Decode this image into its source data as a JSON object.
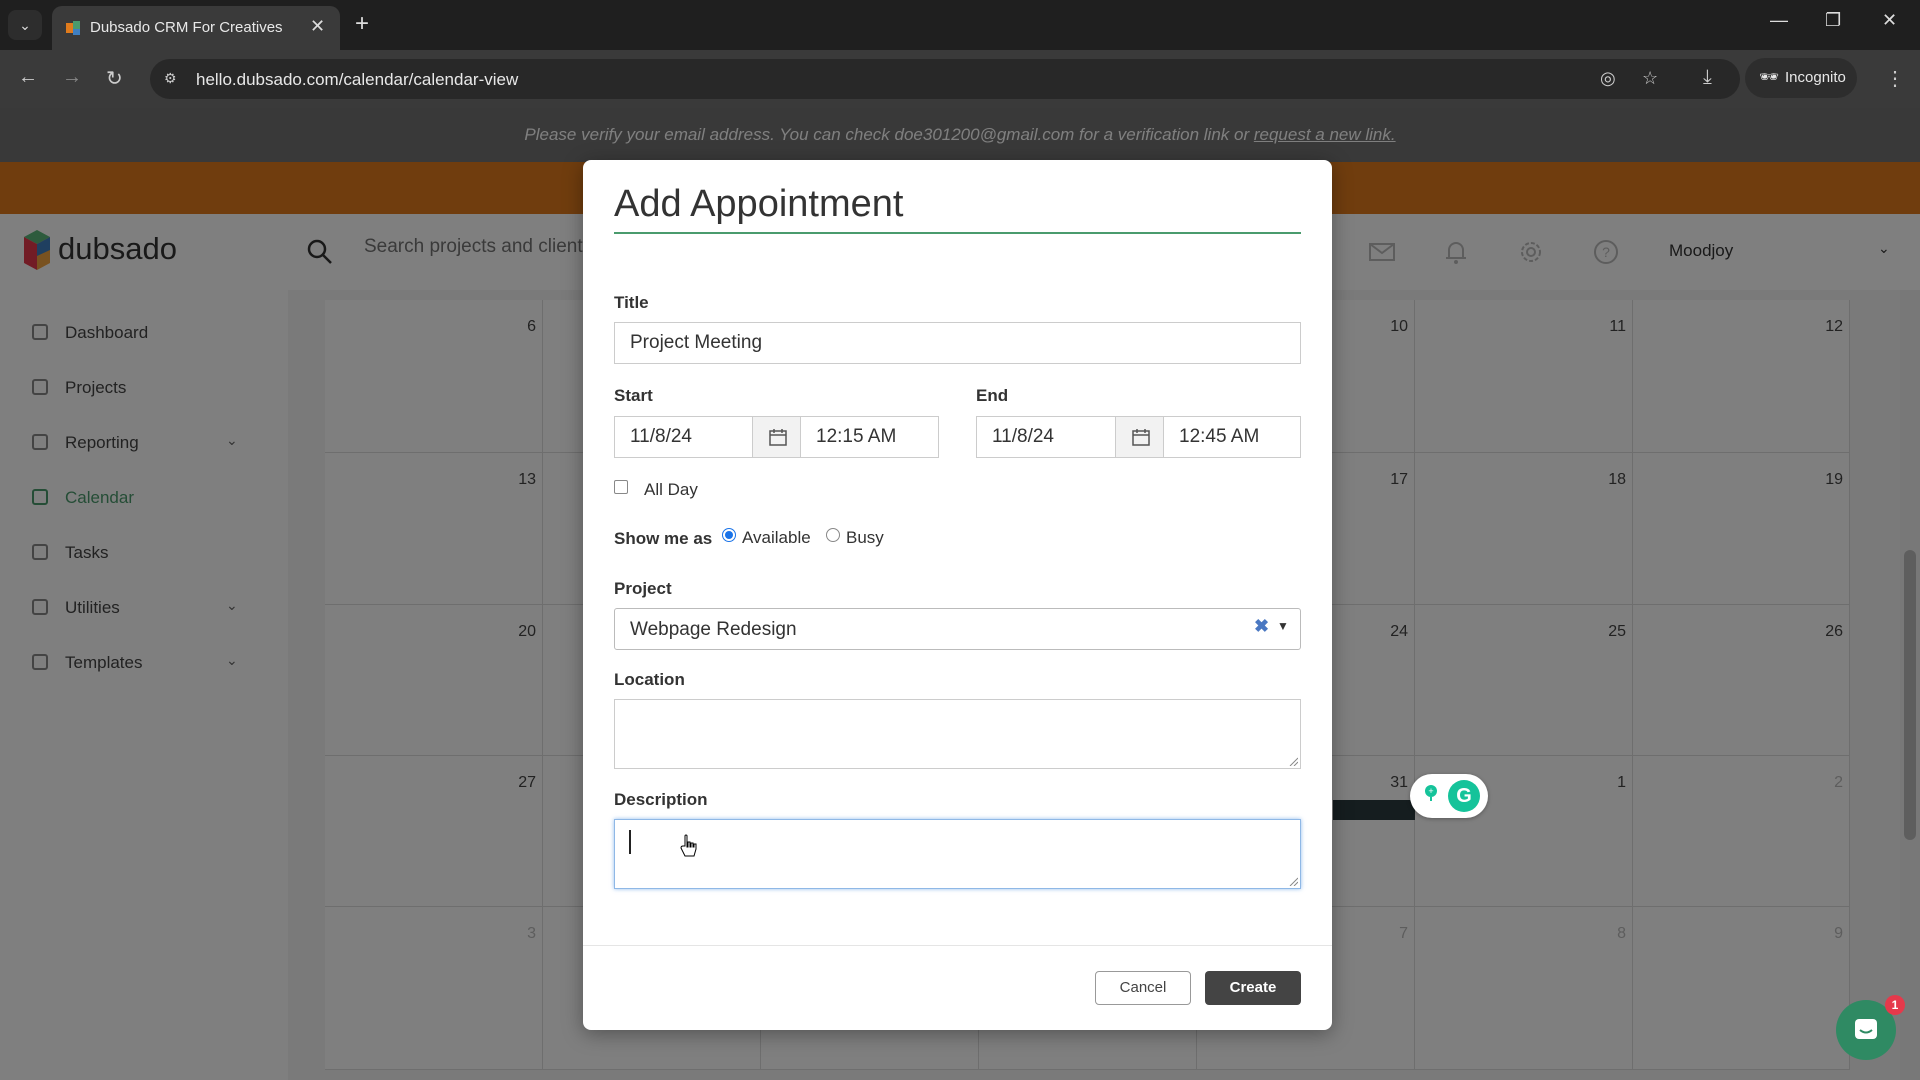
{
  "browser": {
    "tab_title": "Dubsado CRM For Creatives",
    "url": "hello.dubsado.com/calendar/calendar-view",
    "incognito_label": "Incognito"
  },
  "banner": {
    "text": "Please verify your email address. You can check doe301200@gmail.com for a verification link or ",
    "link": "request a new link."
  },
  "header": {
    "logo": "dubsado",
    "search_placeholder": "Search projects and clients",
    "user_name": "Moodjoy"
  },
  "sidebar": {
    "items": [
      {
        "label": "Dashboard"
      },
      {
        "label": "Projects"
      },
      {
        "label": "Reporting"
      },
      {
        "label": "Calendar"
      },
      {
        "label": "Tasks"
      },
      {
        "label": "Utilities"
      },
      {
        "label": "Templates"
      }
    ]
  },
  "calendar": {
    "rows": [
      [
        "",
        "6",
        "",
        "",
        "",
        "10",
        "11",
        "12"
      ],
      [
        "",
        "13",
        "",
        "",
        "",
        "17",
        "18",
        "19"
      ],
      [
        "",
        "20",
        "",
        "",
        "",
        "24",
        "25",
        "26"
      ],
      [
        "",
        "27",
        "",
        "",
        "",
        "31",
        "1",
        "2"
      ],
      [
        "",
        "3",
        "",
        "",
        "",
        "7",
        "8",
        "9"
      ]
    ]
  },
  "modal": {
    "title": "Add Appointment",
    "title_label": "Title",
    "title_value": "Project Meeting",
    "start_label": "Start",
    "start_date": "11/8/24",
    "start_time": "12:15 AM",
    "end_label": "End",
    "end_date": "11/8/24",
    "end_time": "12:45 AM",
    "all_day_label": "All Day",
    "show_me_as_label": "Show me as",
    "available_label": "Available",
    "busy_label": "Busy",
    "project_label": "Project",
    "project_value": "Webpage Redesign",
    "location_label": "Location",
    "description_label": "Description",
    "cancel_label": "Cancel",
    "create_label": "Create"
  },
  "chat": {
    "badge_count": "1"
  },
  "colors": {
    "accent_green": "#4a9b6d",
    "banner_orange": "#e07b1c",
    "create_button": "#444444"
  }
}
